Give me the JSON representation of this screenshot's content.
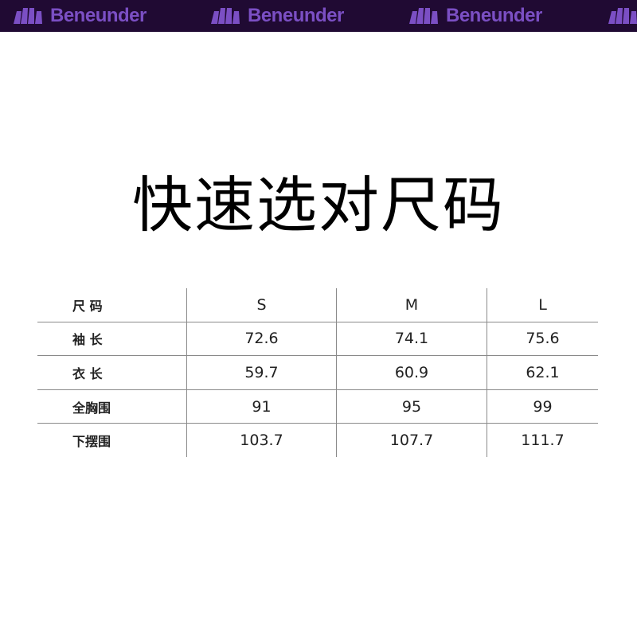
{
  "brand": {
    "name": "Beneunder",
    "colors": {
      "banner_bg": "#200a33",
      "logo": "#7b4fc4"
    }
  },
  "title": "快速选对尺码",
  "size_table": {
    "header": {
      "label": "尺 码",
      "sizes": [
        "S",
        "M",
        "L"
      ]
    },
    "rows": [
      {
        "label": "袖 长",
        "values": [
          "72.6",
          "74.1",
          "75.6"
        ]
      },
      {
        "label": "衣 长",
        "values": [
          "59.7",
          "60.9",
          "62.1"
        ]
      },
      {
        "label": "全胸围",
        "values": [
          "91",
          "95",
          "99"
        ]
      },
      {
        "label": "下摆围",
        "values": [
          "103.7",
          "107.7",
          "111.7"
        ]
      }
    ]
  }
}
